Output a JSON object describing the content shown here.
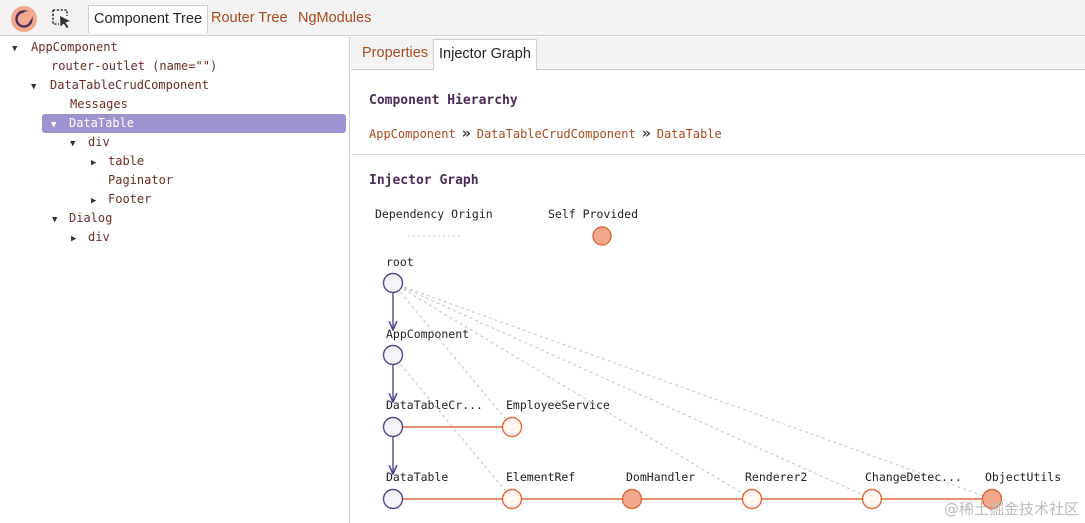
{
  "toolbar": {
    "logo_icon": "angular-devtools-moon-icon",
    "inspect_icon": "inspect-cursor-icon",
    "tabs": [
      {
        "label": "Component Tree",
        "active": true
      },
      {
        "label": "Router Tree",
        "active": false
      },
      {
        "label": "NgModules",
        "active": false
      }
    ]
  },
  "tree": {
    "nodes": [
      {
        "label": "AppComponent",
        "expanded": true,
        "has_children": true
      },
      {
        "label": "router-outlet (name=\"\")",
        "has_children": false
      },
      {
        "label": "DataTableCrudComponent",
        "expanded": true,
        "has_children": true
      },
      {
        "label": "Messages",
        "has_children": false
      },
      {
        "label": "DataTable",
        "expanded": true,
        "has_children": true,
        "selected": true
      },
      {
        "label": "div",
        "expanded": true,
        "has_children": true
      },
      {
        "label": "table",
        "expanded": false,
        "has_children": true
      },
      {
        "label": "Paginator",
        "has_children": false
      },
      {
        "label": "Footer",
        "expanded": false,
        "has_children": true
      },
      {
        "label": "Dialog",
        "expanded": true,
        "has_children": true
      },
      {
        "label": "div",
        "expanded": false,
        "has_children": true
      }
    ]
  },
  "details": {
    "tabs": [
      {
        "label": "Properties",
        "active": false
      },
      {
        "label": "Injector Graph",
        "active": true
      }
    ],
    "hierarchy_title": "Component Hierarchy",
    "breadcrumb": [
      "AppComponent",
      "DataTableCrudComponent",
      "DataTable"
    ],
    "breadcrumb_separator": "»",
    "graph_title": "Injector Graph",
    "legend": {
      "dependency_origin": "Dependency Origin",
      "self_provided": "Self Provided"
    },
    "graph_nodes": {
      "root": "root",
      "app": "AppComponent",
      "crud": "DataTableCr...",
      "employee": "EmployeeService",
      "datatable": "DataTable",
      "elementref": "ElementRef",
      "domhandler": "DomHandler",
      "renderer": "Renderer2",
      "changedetec": "ChangeDetec...",
      "objectutils": "ObjectUtils"
    }
  },
  "colors": {
    "accent": "#a64b1f",
    "selection": "#a091d0",
    "hierarchy_edge": "#4a4a8a",
    "provider_edge": "#e06a3b",
    "self_provided_fill": "#f2a88c"
  },
  "watermark": "@稀土掘金技术社区"
}
